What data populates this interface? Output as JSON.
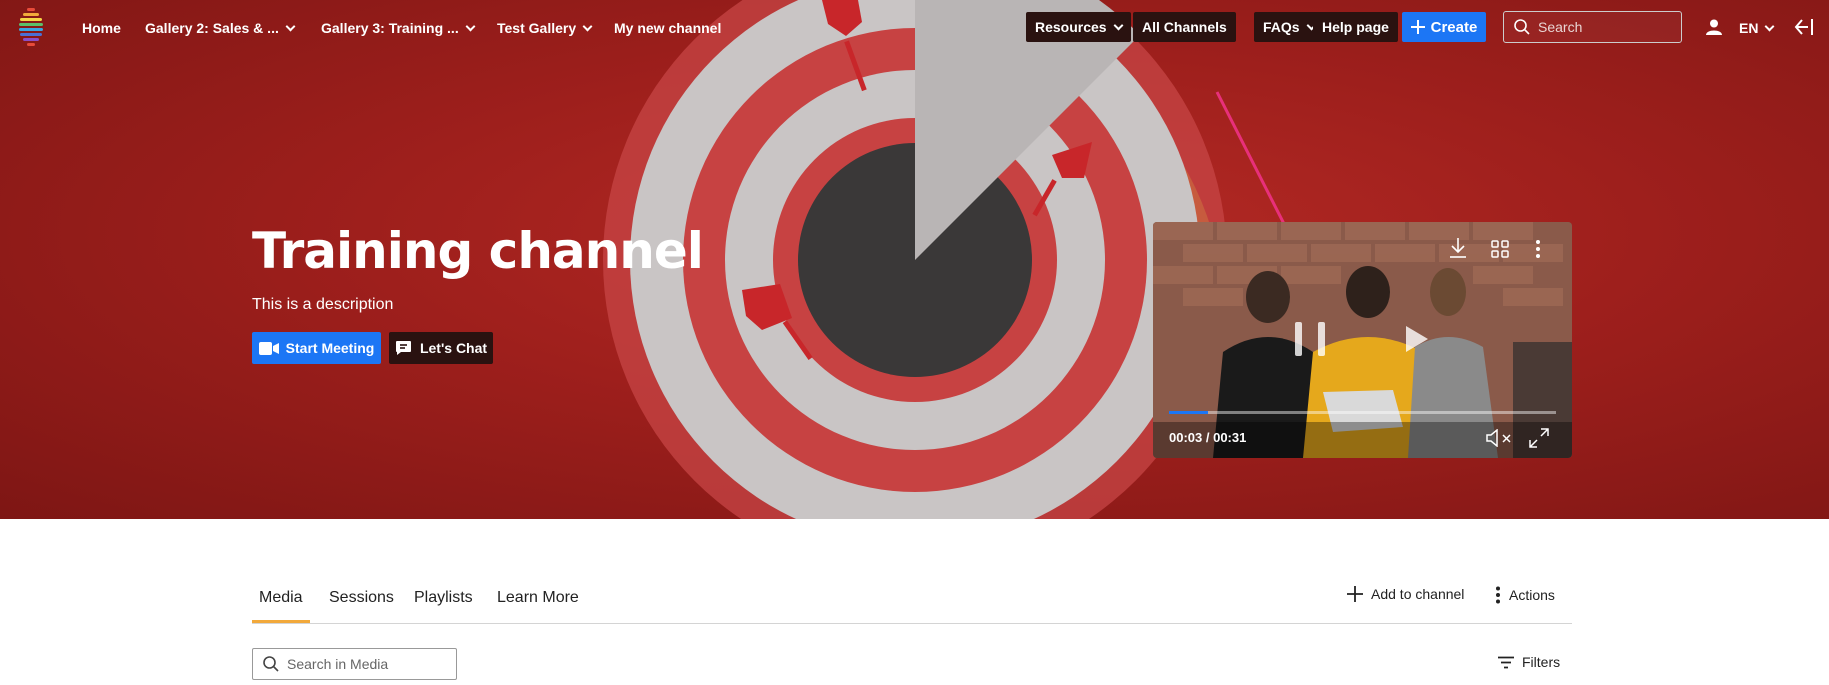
{
  "nav": {
    "items": [
      {
        "label": "Home",
        "dropdown": false
      },
      {
        "label": "Gallery 2: Sales & ...",
        "dropdown": true
      },
      {
        "label": "Gallery 3: Training ...",
        "dropdown": true
      },
      {
        "label": "Test Gallery",
        "dropdown": true
      },
      {
        "label": "My new channel",
        "dropdown": false
      }
    ],
    "buttons": {
      "resources": "Resources",
      "all_channels": "All Channels",
      "faqs": "FAQs",
      "help": "Help page",
      "create": "Create"
    },
    "search_placeholder": "Search",
    "language": "EN"
  },
  "hero": {
    "title": "Training channel",
    "description": "This is a description",
    "start_meeting": "Start Meeting",
    "lets_chat": "Let's Chat"
  },
  "video": {
    "time": "00:03 / 00:31",
    "progress": 0.1
  },
  "tabs": [
    {
      "label": "Media",
      "active": true
    },
    {
      "label": "Sessions",
      "active": false
    },
    {
      "label": "Playlists",
      "active": false
    },
    {
      "label": "Learn More",
      "active": false
    }
  ],
  "toolbar": {
    "add_to_channel": "Add to channel",
    "actions": "Actions",
    "filters": "Filters"
  },
  "media_search_placeholder": "Search in Media",
  "colors": {
    "accent_blue": "#1c76f5",
    "hero_red": "#9e1f1c",
    "active_tab_underline": "#f2a93b",
    "annotation_arrow": "#e8307a"
  }
}
